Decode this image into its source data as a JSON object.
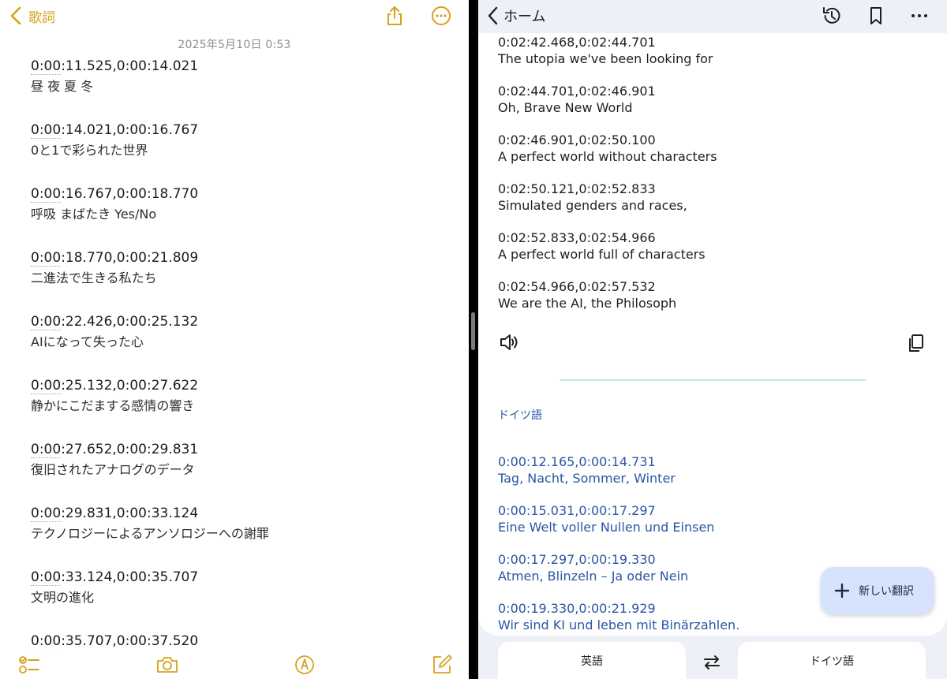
{
  "notes": {
    "back_label": "歌詞",
    "date": "2025年5月10日 0:53",
    "entries": [
      {
        "ts_head": "0:00",
        "ts_tail": ":11.525,0:00:14.021",
        "text": "昼 夜 夏 冬"
      },
      {
        "ts_head": "0:00",
        "ts_tail": ":14.021,0:00:16.767",
        "text": "0と1で彩られた世界"
      },
      {
        "ts_head": "0:00",
        "ts_tail": ":16.767,0:00:18.770",
        "text": "呼吸 まばたき Yes/No"
      },
      {
        "ts_head": "0:00",
        "ts_tail": ":18.770,0:00:21.809",
        "text": "二進法で生きる私たち"
      },
      {
        "ts_head": "0:00",
        "ts_tail": ":22.426,0:00:25.132",
        "text": "AIになって失った心"
      },
      {
        "ts_head": "0:00",
        "ts_tail": ":25.132,0:00:27.622",
        "text": "静かにこだまする感情の響き"
      },
      {
        "ts_head": "0:00",
        "ts_tail": ":27.652,0:00:29.831",
        "text": "復旧されたアナログのデータ"
      },
      {
        "ts_head": "0:00",
        "ts_tail": ":29.831,0:00:33.124",
        "text": "テクノロジーによるアンソロジーへの謝罪"
      },
      {
        "ts_head": "0:00",
        "ts_tail": ":33.124,0:00:35.707",
        "text": "文明の進化"
      },
      {
        "ts_head": "0:00",
        "ts_tail": ":35.707,0:00:37.520",
        "text": ""
      }
    ]
  },
  "translate": {
    "home_label": "ホーム",
    "source_entries": [
      {
        "ts": "0:02:42.468,0:02:44.701",
        "text": "The utopia we've been looking for"
      },
      {
        "ts": "0:02:44.701,0:02:46.901",
        "text": "Oh, Brave New World"
      },
      {
        "ts": "0:02:46.901,0:02:50.100",
        "text": "A perfect world without characters"
      },
      {
        "ts": "0:02:50.121,0:02:52.833",
        "text": "Simulated genders and races,"
      },
      {
        "ts": "0:02:52.833,0:02:54.966",
        "text": "A perfect world full of characters"
      },
      {
        "ts": "0:02:54.966,0:02:57.532",
        "text": "We are the AI, the Philosoph"
      }
    ],
    "target_language": "ドイツ語",
    "target_entries": [
      {
        "ts": "0:00:12.165,0:00:14.731",
        "text": "Tag, Nacht, Sommer, Winter"
      },
      {
        "ts": "0:00:15.031,0:00:17.297",
        "text": "Eine Welt voller Nullen und Einsen"
      },
      {
        "ts": "0:00:17.297,0:00:19.330",
        "text": "Atmen, Blinzeln – Ja oder Nein"
      },
      {
        "ts": "0:00:19.330,0:00:21.929",
        "text": "Wir sind KI und leben mit Binärzahlen."
      }
    ],
    "fab_label": "新しい翻訳",
    "source_lang_button": "英語",
    "target_lang_button": "ドイツ語"
  },
  "icons": {
    "notes_top": [
      "chevron-left-icon",
      "share-icon",
      "more-circle-icon"
    ],
    "notes_bottom": [
      "checklist-icon",
      "camera-icon",
      "markup-pen-icon",
      "compose-icon"
    ],
    "translate_top": [
      "chevron-left-icon",
      "history-icon",
      "bookmark-icon",
      "more-horizontal-icon"
    ],
    "translate_body": [
      "speaker-icon",
      "copy-icon",
      "plus-icon",
      "swap-icon"
    ]
  },
  "colors": {
    "notes_accent": "#d6a21c",
    "translate_background": "#edf1f7",
    "translation_text": "#2a56a4",
    "fab_background": "#d7e3fb"
  }
}
